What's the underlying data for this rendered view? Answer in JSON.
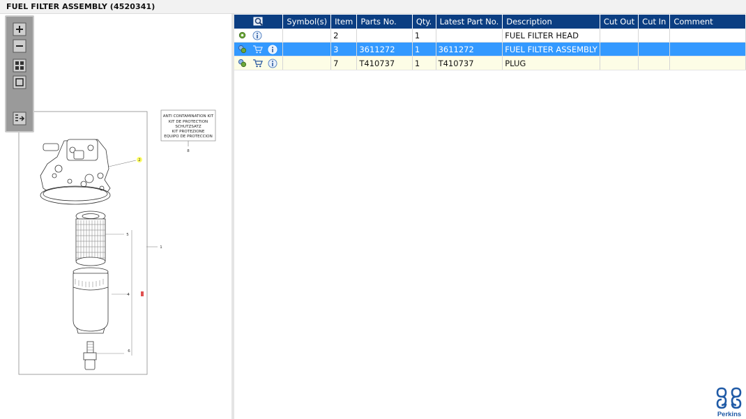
{
  "window": {
    "title": "FUEL FILTER ASSEMBLY (4520341)"
  },
  "drawing": {
    "kit_label_lines": [
      "ANTI CONTAMINATION KIT",
      "KIT DE PROTECTION",
      "SCHUTZSATZ",
      "KIT PROTEZIONE",
      "EQUIPO DE PROTECCION"
    ],
    "callouts": {
      "c8": "8",
      "c2": "2",
      "c1": "1",
      "c5": "5",
      "c4": "4",
      "c6": "6"
    }
  },
  "toolbar": {
    "zoom_in_icon": "zoom-in-icon",
    "zoom_out_icon": "zoom-out-icon",
    "fit_icon": "grid-fit-icon",
    "actual_icon": "square-icon",
    "list_icon": "list-export-icon"
  },
  "grid": {
    "columns": [
      "Symbol(s)",
      "Item",
      "Parts No.",
      "Qty.",
      "Latest Part No.",
      "Description",
      "Cut Out",
      "Cut In",
      "Comment"
    ],
    "rows": [
      {
        "item": "2",
        "parts_no": "",
        "qty": "1",
        "latest": "",
        "description": "FUEL FILTER HEAD",
        "cut_out": "",
        "cut_in": "",
        "comment": ""
      },
      {
        "item": "3",
        "parts_no": "3611272",
        "qty": "1",
        "latest": "3611272",
        "description": "FUEL FILTER ASSEMBLY",
        "cut_out": "",
        "cut_in": "",
        "comment": ""
      },
      {
        "item": "7",
        "parts_no": "T410737",
        "qty": "1",
        "latest": "T410737",
        "description": "PLUG",
        "cut_out": "",
        "cut_in": "",
        "comment": ""
      }
    ],
    "selected_row": 1
  },
  "brand": {
    "name": "Perkins",
    "color": "#1f5aa6"
  },
  "colors": {
    "header_bg": "#0b3e82",
    "selected_row": "#3399ff",
    "highlight_row": "#fdfde6",
    "callout_highlight": "#ffff66",
    "callout_red": "#e05050"
  }
}
